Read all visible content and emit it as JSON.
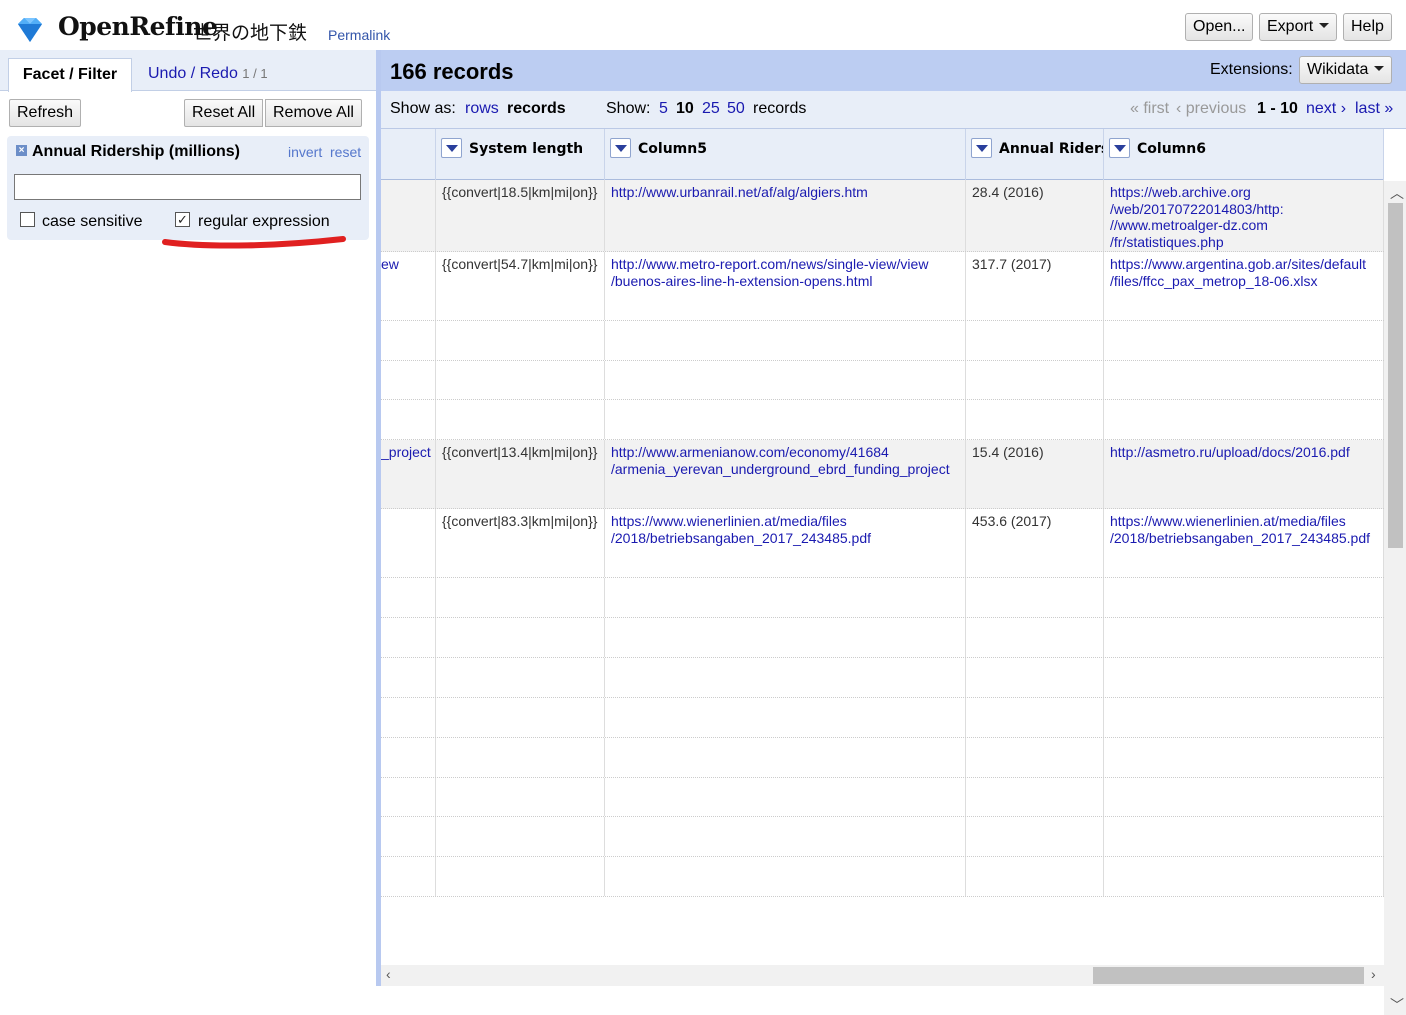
{
  "header": {
    "app_name": "OpenRefine",
    "project_name": "世界の地下鉄",
    "permalink": "Permalink",
    "open_label": "Open...",
    "export_label": "Export",
    "help_label": "Help"
  },
  "left": {
    "tab_facet": "Facet / Filter",
    "tab_undo": "Undo / Redo",
    "undo_count": "1 / 1",
    "refresh": "Refresh",
    "reset_all": "Reset All",
    "remove_all": "Remove All",
    "facet": {
      "title": "Annual Ridership (millions)",
      "invert": "invert",
      "reset": "reset",
      "close": "×",
      "case_label": "case sensitive",
      "case_checked": false,
      "regex_label": "regular expression",
      "regex_checked": true,
      "input_value": ""
    }
  },
  "summary": {
    "record_count": "166 records",
    "extensions_label": "Extensions:",
    "wikidata": "Wikidata"
  },
  "viewbar": {
    "show_as": "Show as:",
    "rows": "rows",
    "records": "records",
    "show": "Show:",
    "opt5": "5",
    "opt10": "10",
    "opt25": "25",
    "opt50": "50",
    "records_suffix": "records",
    "first": "« first",
    "previous": "‹ previous",
    "range": "1 - 10",
    "next": "next ›",
    "last": "last »"
  },
  "columns": [
    "System length",
    "Column5",
    "Annual Ridersh",
    "Column6"
  ],
  "rows": [
    {
      "c0": "",
      "c1": "{{convert|18.5|km|mi|on}}",
      "c2a": "http://www.urbanrail.net/af/alg/algiers.htm",
      "c2b": "",
      "c3": "28.4 (2016)",
      "c4a": "https://web.archive.org",
      "c4b": "/web/20170722014803/http:",
      "c4c": "//www.metroalger-dz.com",
      "c4d": "/fr/statistiques.php"
    },
    {
      "c0": "ew",
      "c1": "{{convert|54.7|km|mi|on}}",
      "c2a": "http://www.metro-report.com/news/single-view/view",
      "c2b": "/buenos-aires-line-h-extension-opens.html",
      "c3": "317.7 (2017)",
      "c4a": "https://www.argentina.gob.ar/sites/default",
      "c4b": "/files/ffcc_pax_metrop_18-06.xlsx",
      "c4c": "",
      "c4d": ""
    },
    {
      "c0": "",
      "c1": "",
      "c2a": "",
      "c2b": "",
      "c3": "",
      "c4a": "",
      "c4b": "",
      "c4c": "",
      "c4d": ""
    },
    {
      "c0": "",
      "c1": "",
      "c2a": "",
      "c2b": "",
      "c3": "",
      "c4a": "",
      "c4b": "",
      "c4c": "",
      "c4d": ""
    },
    {
      "c0": "",
      "c1": "",
      "c2a": "",
      "c2b": "",
      "c3": "",
      "c4a": "",
      "c4b": "",
      "c4c": "",
      "c4d": ""
    },
    {
      "c0": "_project",
      "c1": "{{convert|13.4|km|mi|on}}",
      "c2a": "http://www.armenianow.com/economy/41684",
      "c2b": "/armenia_yerevan_underground_ebrd_funding_project",
      "c3": "15.4 (2016)",
      "c4a": "http://asmetro.ru/upload/docs/2016.pdf",
      "c4b": "",
      "c4c": "",
      "c4d": ""
    },
    {
      "c0": "",
      "c1": "{{convert|83.3|km|mi|on}}",
      "c2a": "https://www.wienerlinien.at/media/files",
      "c2b": "/2018/betriebsangaben_2017_243485.pdf",
      "c3": "453.6 (2017)",
      "c4a": "https://www.wienerlinien.at/media/files",
      "c4b": "/2018/betriebsangaben_2017_243485.pdf",
      "c4c": "",
      "c4d": ""
    },
    {
      "c0": "",
      "c1": "",
      "c2a": "",
      "c2b": "",
      "c3": "",
      "c4a": "",
      "c4b": "",
      "c4c": "",
      "c4d": ""
    },
    {
      "c0": "",
      "c1": "",
      "c2a": "",
      "c2b": "",
      "c3": "",
      "c4a": "",
      "c4b": "",
      "c4c": "",
      "c4d": ""
    },
    {
      "c0": "",
      "c1": "",
      "c2a": "",
      "c2b": "",
      "c3": "",
      "c4a": "",
      "c4b": "",
      "c4c": "",
      "c4d": ""
    },
    {
      "c0": "",
      "c1": "",
      "c2a": "",
      "c2b": "",
      "c3": "",
      "c4a": "",
      "c4b": "",
      "c4c": "",
      "c4d": ""
    },
    {
      "c0": "",
      "c1": "",
      "c2a": "",
      "c2b": "",
      "c3": "",
      "c4a": "",
      "c4b": "",
      "c4c": "",
      "c4d": ""
    },
    {
      "c0": "",
      "c1": "",
      "c2a": "",
      "c2b": "",
      "c3": "",
      "c4a": "",
      "c4b": "",
      "c4c": "",
      "c4d": ""
    },
    {
      "c0": "",
      "c1": "",
      "c2a": "",
      "c2b": "",
      "c3": "",
      "c4a": "",
      "c4b": "",
      "c4c": "",
      "c4d": ""
    },
    {
      "c0": "",
      "c1": "",
      "c2a": "",
      "c2b": "",
      "c3": "",
      "c4a": "",
      "c4b": "",
      "c4c": "",
      "c4d": ""
    }
  ],
  "colors": {
    "accent": "#bccdf2",
    "link": "#1a1ab0",
    "annotation": "#e02020"
  }
}
